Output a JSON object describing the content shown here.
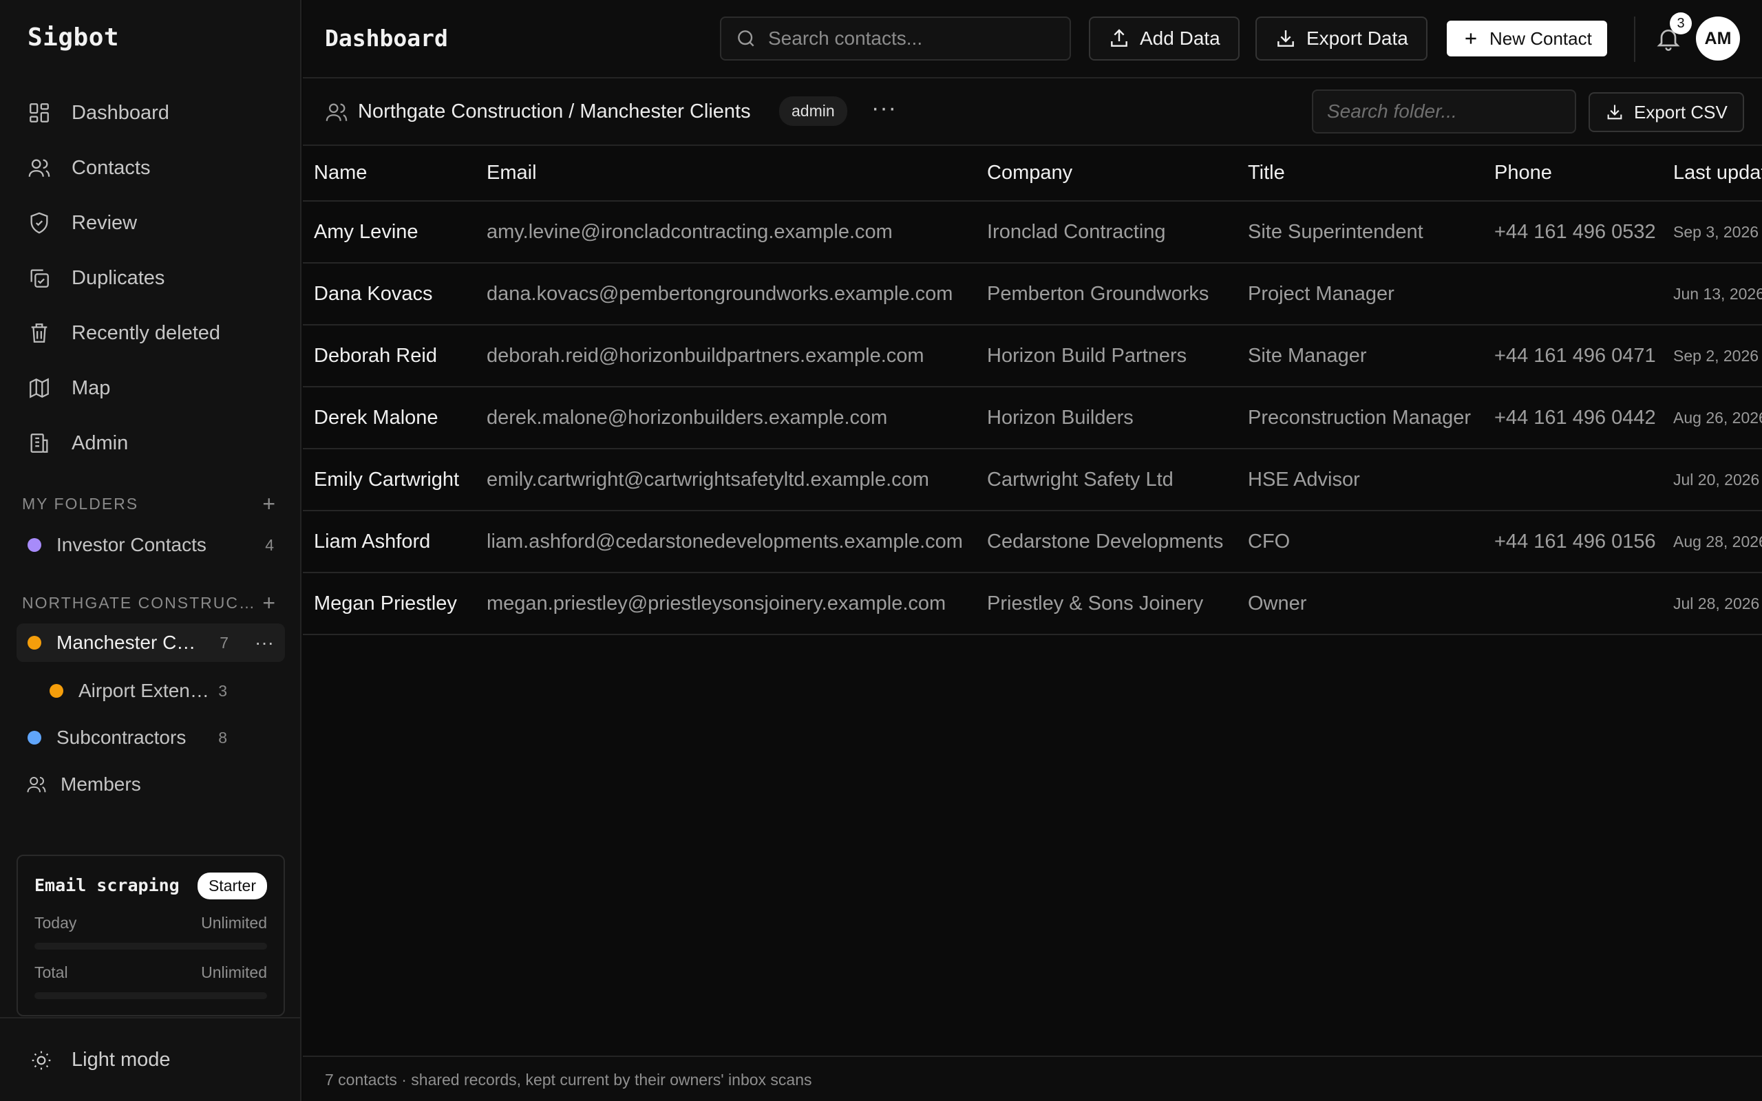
{
  "app": {
    "name": "Sigbot"
  },
  "sidebar": {
    "nav": [
      {
        "label": "Dashboard",
        "icon": "dashboard-grid-icon"
      },
      {
        "label": "Contacts",
        "icon": "users-icon"
      },
      {
        "label": "Review",
        "icon": "shield-icon"
      },
      {
        "label": "Duplicates",
        "icon": "copy-check-icon"
      },
      {
        "label": "Recently deleted",
        "icon": "trash-icon"
      },
      {
        "label": "Map",
        "icon": "map-icon"
      },
      {
        "label": "Admin",
        "icon": "building-icon"
      }
    ],
    "my_folders_title": "MY FOLDERS",
    "my_folders": [
      {
        "name": "Investor Contacts",
        "count": "4",
        "color": "#a78bfa"
      }
    ],
    "org_title": "NORTHGATE CONSTRUCTION",
    "org_folders": [
      {
        "name": "Manchester Clients",
        "count": "7",
        "color": "#f59e0b"
      },
      {
        "name": "Airport Extension",
        "count": "3",
        "color": "#f59e0b"
      },
      {
        "name": "Subcontractors",
        "count": "8",
        "color": "#60a5fa"
      }
    ],
    "members_label": "Members",
    "usage": {
      "title": "Email scraping",
      "plan": "Starter",
      "today_label": "Today",
      "today_value": "Unlimited",
      "total_label": "Total",
      "total_value": "Unlimited"
    },
    "theme_toggle_label": "Light mode"
  },
  "header": {
    "title": "Dashboard",
    "search_placeholder": "Search contacts...",
    "add_data_label": "Add Data",
    "export_data_label": "Export Data",
    "new_contact_label": "New Contact",
    "notification_count": "3",
    "avatar_initials": "AM"
  },
  "folderbar": {
    "breadcrumb": "Northgate Construction / Manchester Clients",
    "role": "admin",
    "more": "···",
    "search_placeholder": "Search folder...",
    "export_csv_label": "Export CSV"
  },
  "table": {
    "columns": [
      "Name",
      "Email",
      "Company",
      "Title",
      "Phone",
      "Last updated"
    ],
    "rows": [
      [
        "Amy Levine",
        "amy.levine@ironcladcontracting.example.com",
        "Ironclad Contracting",
        "Site Superintendent",
        "+44 161 496 0532",
        "Sep 3, 2026"
      ],
      [
        "Dana Kovacs",
        "dana.kovacs@pembertongroundworks.example.com",
        "Pemberton Groundworks",
        "Project Manager",
        "",
        "Jun 13, 2026"
      ],
      [
        "Deborah Reid",
        "deborah.reid@horizonbuildpartners.example.com",
        "Horizon Build Partners",
        "Site Manager",
        "+44 161 496 0471",
        "Sep 2, 2026"
      ],
      [
        "Derek Malone",
        "derek.malone@horizonbuilders.example.com",
        "Horizon Builders",
        "Preconstruction Manager",
        "+44 161 496 0442",
        "Aug 26, 2026"
      ],
      [
        "Emily Cartwright",
        "emily.cartwright@cartwrightsafetyltd.example.com",
        "Cartwright Safety Ltd",
        "HSE Advisor",
        "",
        "Jul 20, 2026"
      ],
      [
        "Liam Ashford",
        "liam.ashford@cedarstonedevelopments.example.com",
        "Cedarstone Developments",
        "CFO",
        "+44 161 496 0156",
        "Aug 28, 2026"
      ],
      [
        "Megan Priestley",
        "megan.priestley@priestleysonsjoinery.example.com",
        "Priestley & Sons Joinery",
        "Owner",
        "",
        "Jul 28, 2026"
      ]
    ]
  },
  "footer": {
    "text": "7 contacts · shared records, kept current by their owners' inbox scans"
  }
}
